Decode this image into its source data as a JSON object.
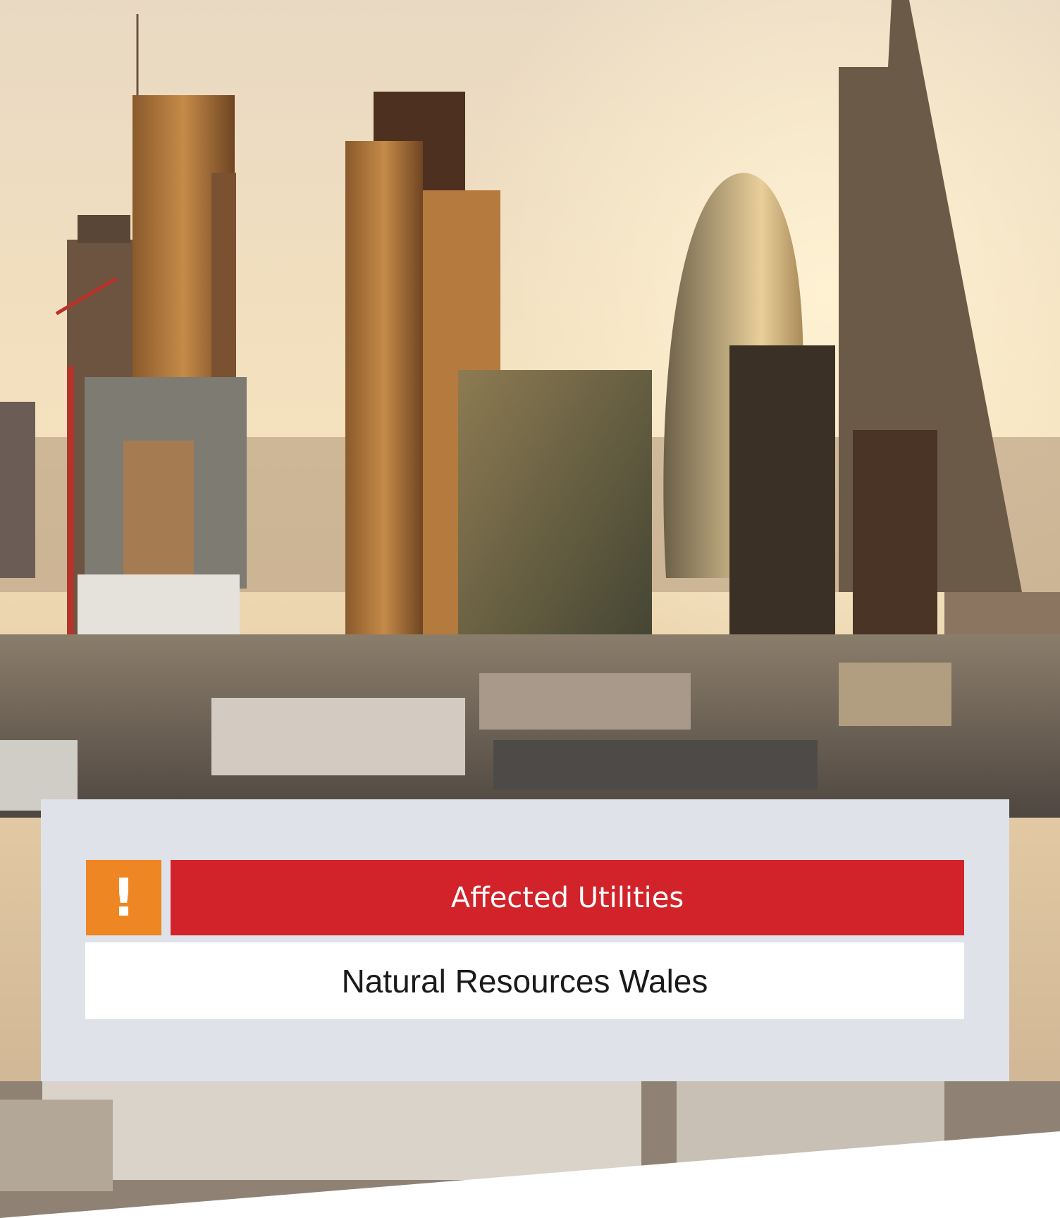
{
  "alert": {
    "icon": "exclamation-icon",
    "icon_glyph": "!",
    "title": "Affected Utilities",
    "value": "Natural Resources Wales"
  },
  "colors": {
    "icon_bg": "#ee8623",
    "header_bg": "#d2232a",
    "panel_bg": "#dfe2e9"
  }
}
